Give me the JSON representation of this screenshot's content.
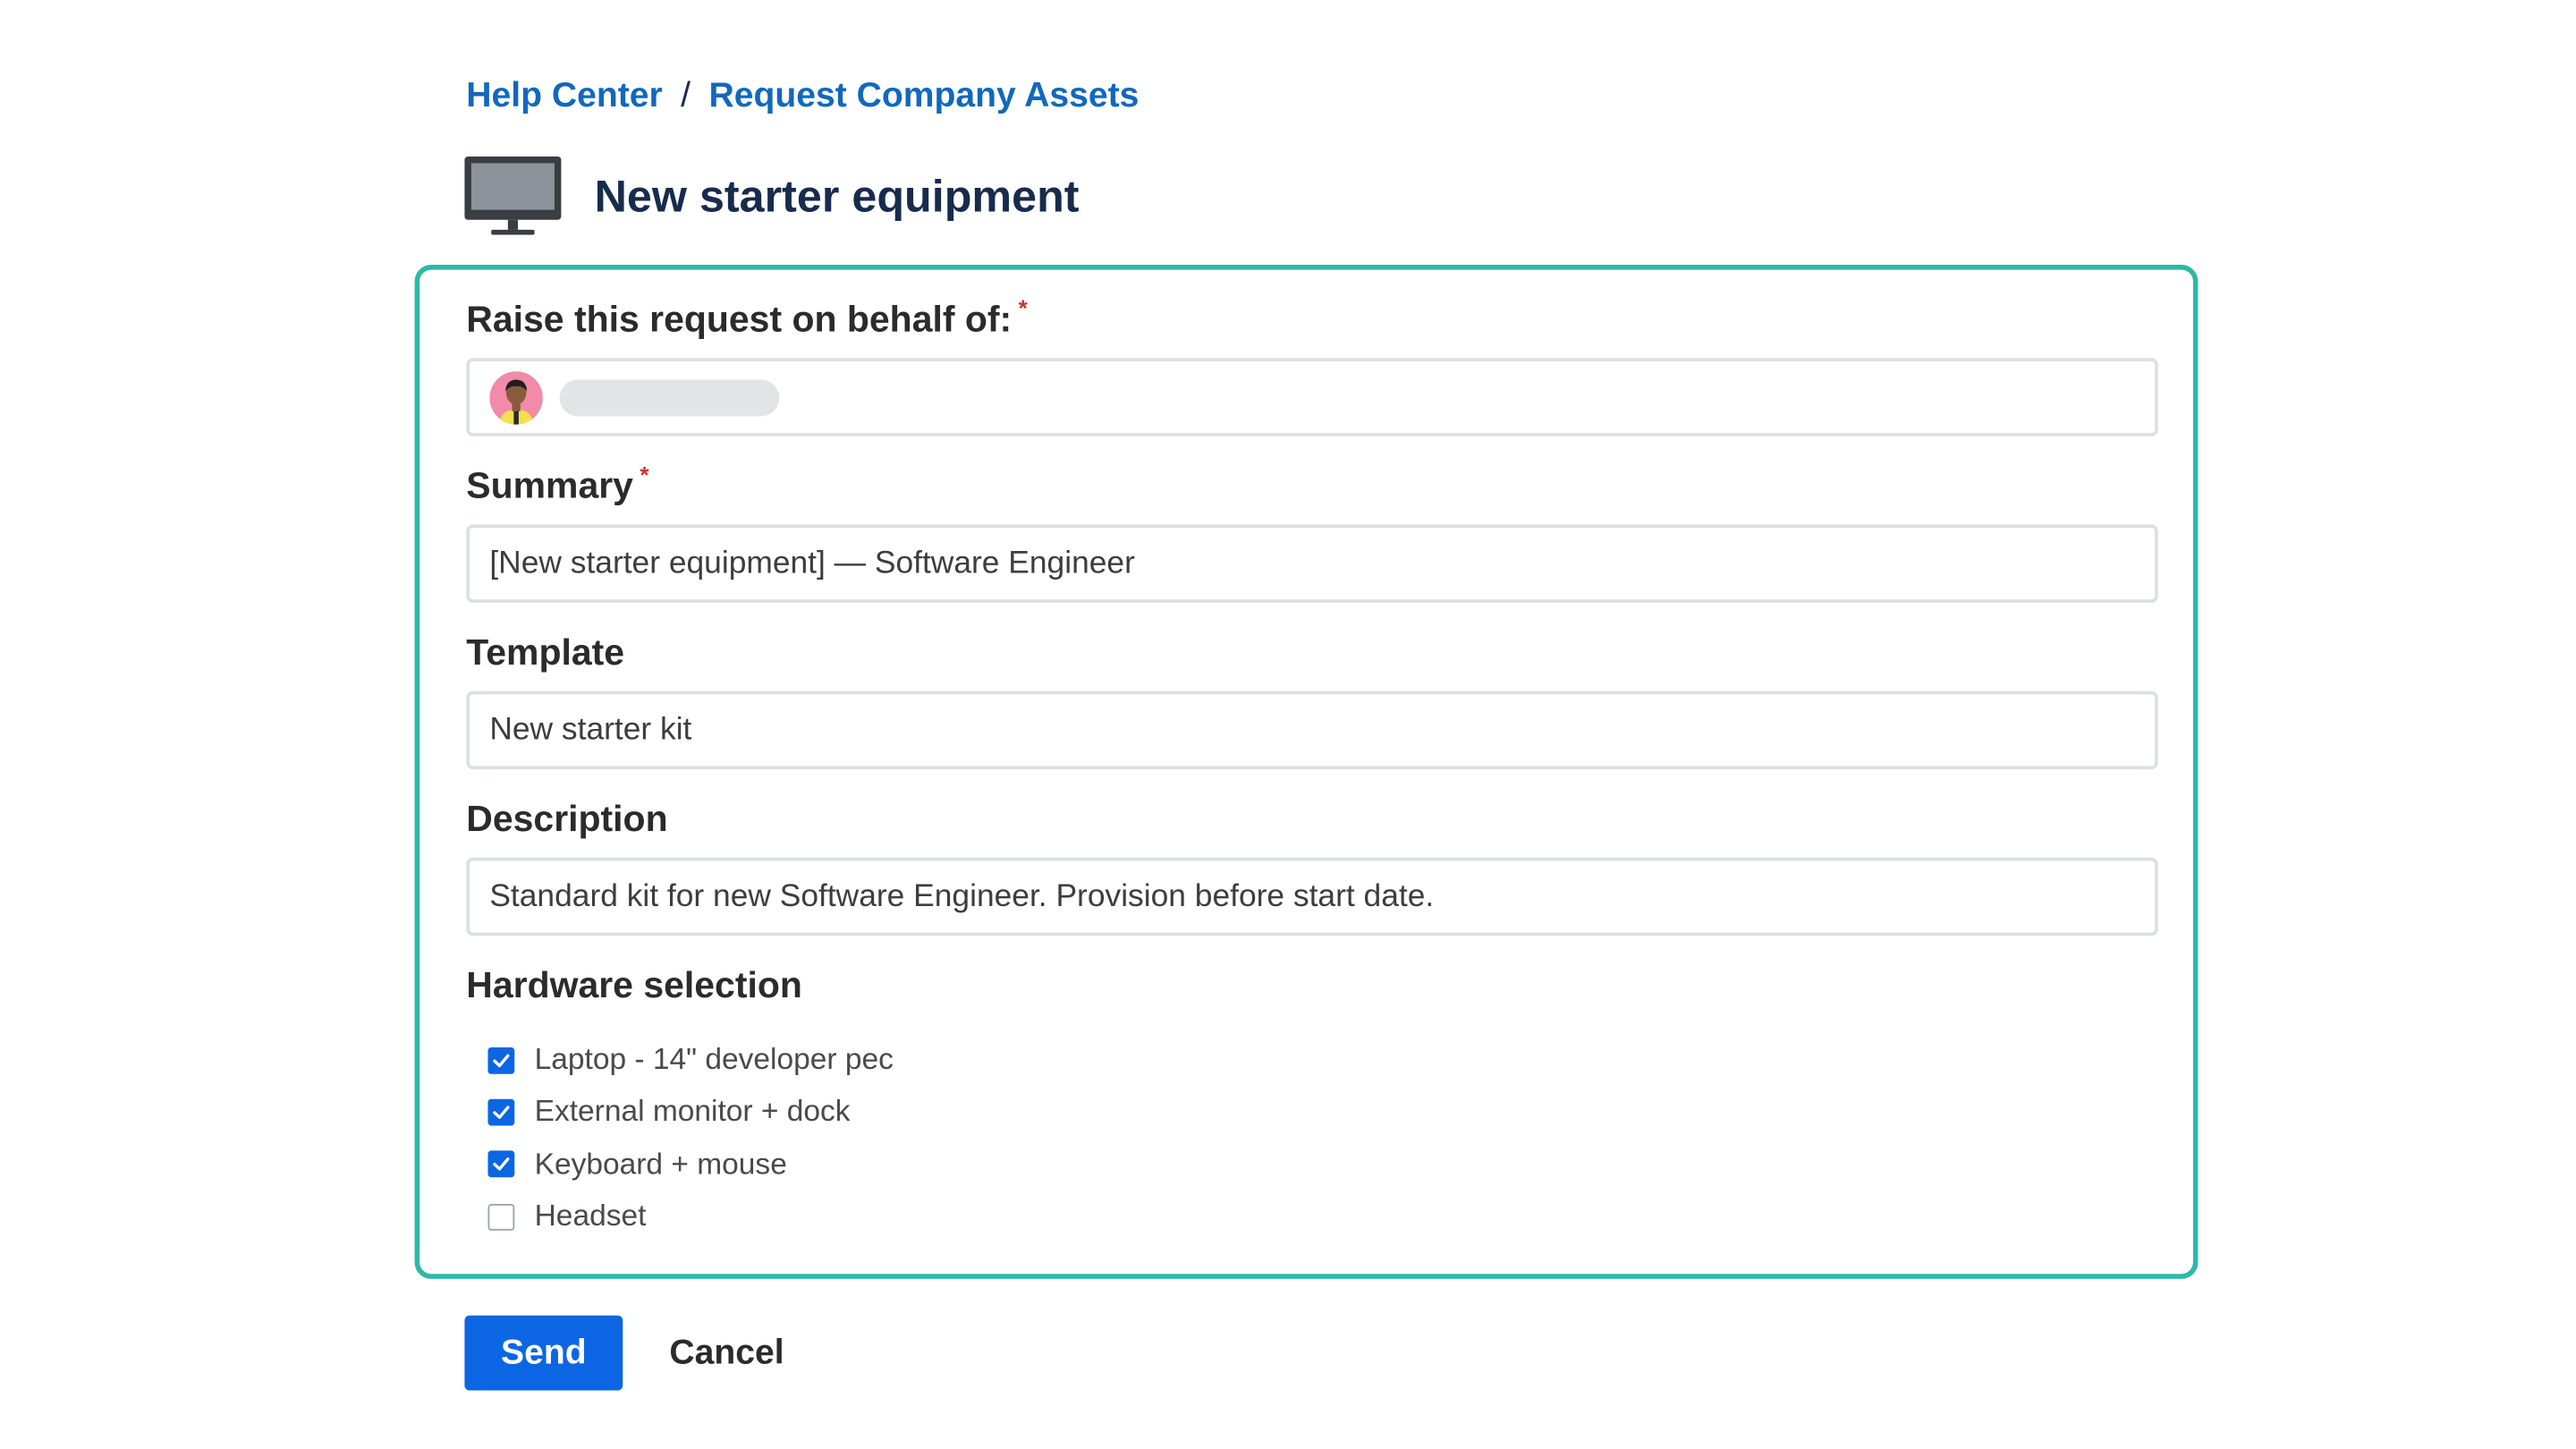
{
  "breadcrumb": {
    "home": "Help Center",
    "separator": "/",
    "current": "Request Company Assets"
  },
  "header": {
    "icon": "monitor-icon",
    "title": "New starter equipment"
  },
  "form": {
    "on_behalf": {
      "label": "Raise this request on behalf of:",
      "required_mark": "*",
      "avatar_icon": "user-avatar"
    },
    "summary": {
      "label": "Summary",
      "required_mark": "*",
      "value": "[New starter equipment] — Software Engineer"
    },
    "template": {
      "label": "Template",
      "value": "New starter kit"
    },
    "description": {
      "label": "Description",
      "value": "Standard kit for new Software Engineer. Provision before start date."
    },
    "hardware": {
      "label": "Hardware selection",
      "items": [
        {
          "label": "Laptop - 14\" developer pec",
          "checked": true
        },
        {
          "label": "External monitor + dock",
          "checked": true
        },
        {
          "label": "Keyboard + mouse",
          "checked": true
        },
        {
          "label": "Headset",
          "checked": false
        }
      ]
    }
  },
  "actions": {
    "send_label": "Send",
    "cancel_label": "Cancel"
  },
  "colors": {
    "link": "#1168bd",
    "primary": "#0c66e4",
    "card_border": "#2db8a8",
    "required": "#d0312d"
  }
}
